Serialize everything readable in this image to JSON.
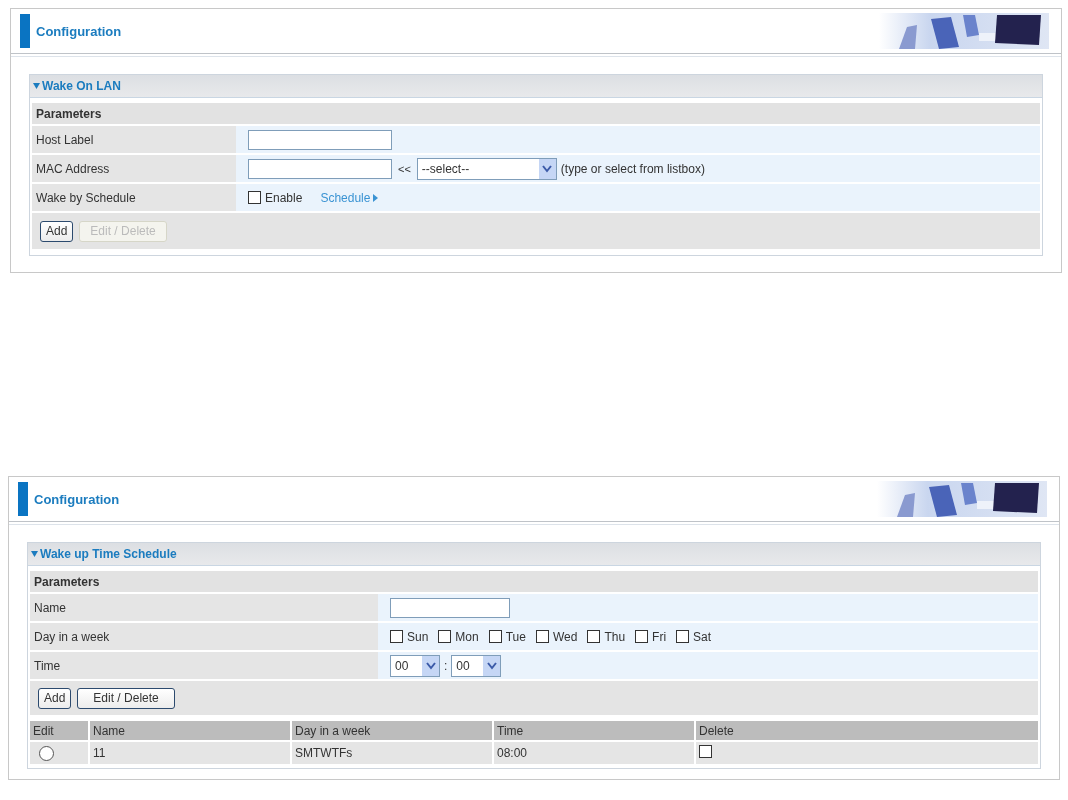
{
  "panels": [
    {
      "kind": "wol",
      "title": "Configuration",
      "section": {
        "title": "Wake On LAN",
        "expanded": true
      },
      "params_title": "Parameters",
      "rows": [
        {
          "kind": "text",
          "label": "Host Label"
        },
        {
          "kind": "mac",
          "label": "MAC Address",
          "separator": "<<",
          "select": "--select--",
          "hint": "(type or select from listbox)"
        },
        {
          "kind": "schedule",
          "label": "Wake by Schedule",
          "checkbox": {
            "label": "Enable",
            "checked": false
          },
          "link": "Schedule"
        }
      ],
      "buttons": [
        {
          "label": "Add",
          "disabled": false
        },
        {
          "label": "Edit / Delete",
          "disabled": true
        }
      ]
    },
    {
      "kind": "schedule",
      "title": "Configuration",
      "section": {
        "title": "Wake up Time Schedule",
        "expanded": true
      },
      "params_title": "Parameters",
      "rows": [
        {
          "kind": "text",
          "label": "Name"
        },
        {
          "kind": "days",
          "label": "Day in a week",
          "days": [
            {
              "label": "Sun",
              "checked": false
            },
            {
              "label": "Mon",
              "checked": false
            },
            {
              "label": "Tue",
              "checked": false
            },
            {
              "label": "Wed",
              "checked": false
            },
            {
              "label": "Thu",
              "checked": false
            },
            {
              "label": "Fri",
              "checked": false
            },
            {
              "label": "Sat",
              "checked": false
            }
          ]
        },
        {
          "kind": "time",
          "label": "Time",
          "hour": "00",
          "separator": ":",
          "minute": "00"
        }
      ],
      "buttons": [
        {
          "label": "Add",
          "disabled": false
        },
        {
          "label": "Edit / Delete",
          "disabled": false
        }
      ],
      "table": {
        "columns": [
          "Edit",
          "Name",
          "Day in a week",
          "Time",
          "Delete"
        ],
        "rows": [
          {
            "selected": false,
            "name": "11",
            "days": "SMTWTFs",
            "time": "08:00",
            "delete": false
          }
        ]
      }
    }
  ]
}
